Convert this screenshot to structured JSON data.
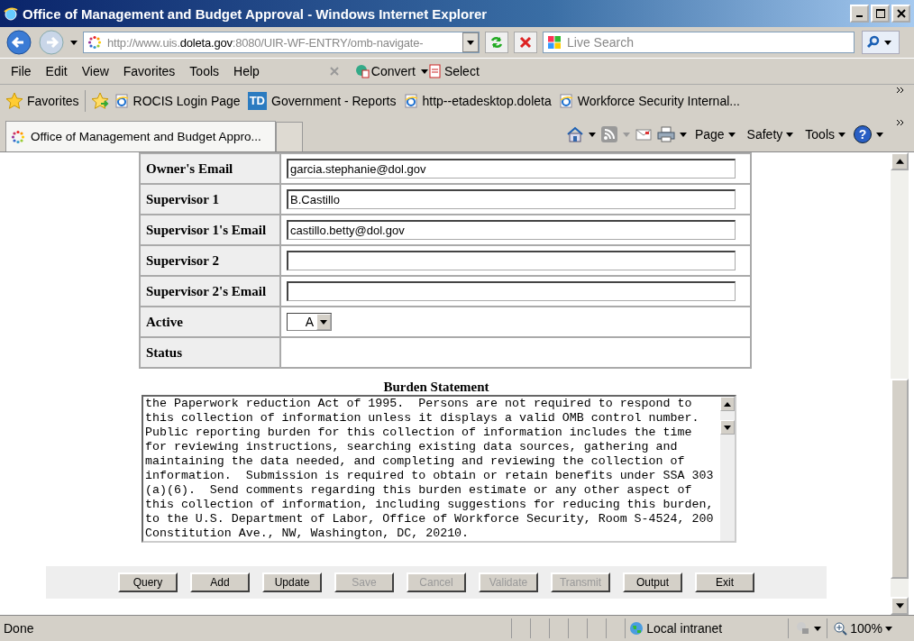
{
  "window": {
    "title": "Office of Management and Budget Approval - Windows Internet Explorer"
  },
  "address_bar": {
    "prefix": "http://www.uis.",
    "domain": "doleta.gov",
    "path": ":8080/UIR-WF-ENTRY/omb-navigate-"
  },
  "search": {
    "placeholder": "Live Search"
  },
  "menu": [
    "File",
    "Edit",
    "View",
    "Favorites",
    "Tools",
    "Help"
  ],
  "toolbar": [
    {
      "label": "Convert",
      "kind": "convert"
    },
    {
      "label": "Select",
      "kind": "select"
    }
  ],
  "favorites_bar": {
    "label": "Favorites",
    "links": [
      {
        "label": "ROCIS Login Page",
        "kind": "ie"
      },
      {
        "label": "Government - Reports",
        "kind": "td",
        "icon_text": "TD"
      },
      {
        "label": "http--etadesktop.doleta",
        "kind": "ie"
      },
      {
        "label": "Workforce Security Internal...",
        "kind": "ie"
      }
    ]
  },
  "tab": {
    "title": "Office of Management and Budget Appro..."
  },
  "command_bar": [
    "Page",
    "Safety",
    "Tools"
  ],
  "help_button": {
    "label": "?"
  },
  "form": {
    "rows": [
      {
        "label": "Owner's Email",
        "kind": "text",
        "value": "garcia.stephanie@dol.gov"
      },
      {
        "label": "Supervisor 1",
        "kind": "text",
        "value": "B.Castillo"
      },
      {
        "label": "Supervisor 1's Email",
        "kind": "text",
        "value": "castillo.betty@dol.gov"
      },
      {
        "label": "Supervisor 2",
        "kind": "text",
        "value": ""
      },
      {
        "label": "Supervisor 2's Email",
        "kind": "text",
        "value": ""
      },
      {
        "label": "Active",
        "kind": "select",
        "value": "A"
      },
      {
        "label": "Status",
        "kind": "static",
        "value": ""
      }
    ]
  },
  "burden": {
    "title": "Burden Statement",
    "text": "the Paperwork reduction Act of 1995.  Persons are not required to respond to\nthis collection of information unless it displays a valid OMB control number.\nPublic reporting burden for this collection of information includes the time\nfor reviewing instructions, searching existing data sources, gathering and\nmaintaining the data needed, and completing and reviewing the collection of\ninformation.  Submission is required to obtain or retain benefits under SSA 303\n(a)(6).  Send comments regarding this burden estimate or any other aspect of\nthis collection of information, including suggestions for reducing this burden,\nto the U.S. Department of Labor, Office of Workforce Security, Room S-4524, 200\nConstitution Ave., NW, Washington, DC, 20210."
  },
  "buttons": [
    {
      "label": "Query",
      "disabled": false
    },
    {
      "label": "Add",
      "disabled": false
    },
    {
      "label": "Update",
      "disabled": false
    },
    {
      "label": "Save",
      "disabled": true
    },
    {
      "label": "Cancel",
      "disabled": true
    },
    {
      "label": "Validate",
      "disabled": true
    },
    {
      "label": "Transmit",
      "disabled": true
    },
    {
      "label": "Output",
      "disabled": false
    },
    {
      "label": "Exit",
      "disabled": false
    }
  ],
  "status_bar": {
    "text": "Done",
    "zone": "Local intranet",
    "zoom": "100%"
  }
}
